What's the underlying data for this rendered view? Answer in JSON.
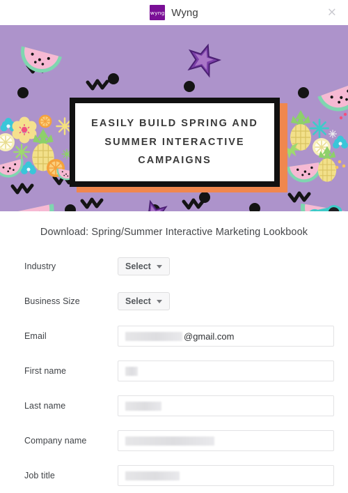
{
  "header": {
    "brand_mark": "wyng",
    "brand_name": "Wyng",
    "close_icon": "close-icon",
    "close_glyph": "×"
  },
  "hero": {
    "background_color": "#AD93CB",
    "accent_color": "#F0874E",
    "frame_color": "#111111",
    "headline": "EASILY BUILD SPRING AND SUMMER INTERACTIVE CAMPAIGNS",
    "decorations": [
      "watermelon-slice",
      "pineapple",
      "orange-slice",
      "lemon-slice",
      "flower",
      "starburst",
      "starfish",
      "sunglasses",
      "dot",
      "zigzag"
    ]
  },
  "form": {
    "title": "Download: Spring/Summer Interactive Marketing Lookbook",
    "select_label": "Select",
    "fields": [
      {
        "label": "Industry",
        "type": "select",
        "value": "Select"
      },
      {
        "label": "Business Size",
        "type": "select",
        "value": "Select"
      },
      {
        "label": "Email",
        "type": "text",
        "value": "@gmail.com",
        "redacted_width": 82,
        "placeholder": ""
      },
      {
        "label": "First name",
        "type": "text",
        "value": "",
        "redacted_width": 18,
        "placeholder": ""
      },
      {
        "label": "Last name",
        "type": "text",
        "value": "",
        "redacted_width": 52,
        "placeholder": ""
      },
      {
        "label": "Company name",
        "type": "text",
        "value": "",
        "redacted_width": 128,
        "placeholder": ""
      },
      {
        "label": "Job title",
        "type": "text",
        "value": "",
        "redacted_width": 78,
        "placeholder": ""
      }
    ]
  }
}
